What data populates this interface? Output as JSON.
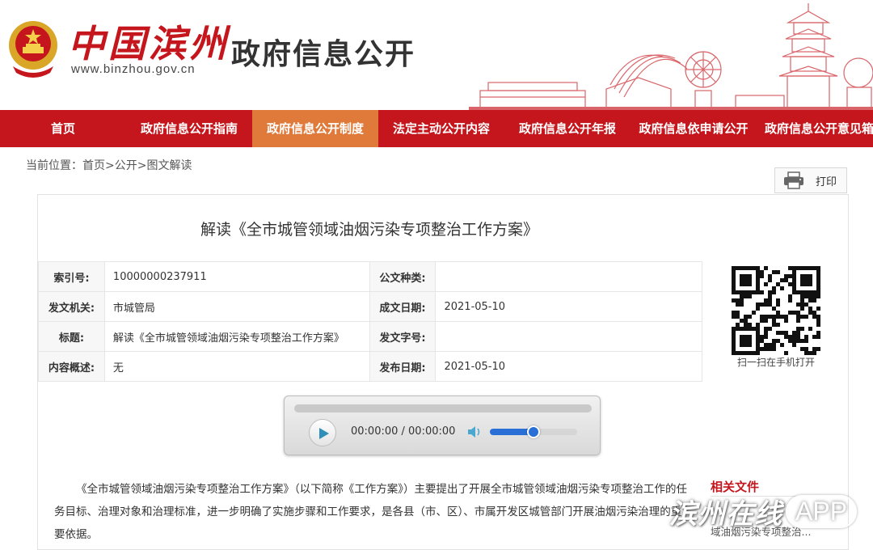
{
  "header": {
    "logo_text": "中国滨州",
    "logo_url": "www.binzhou.gov.cn",
    "site_title": "政府信息公开",
    "brand_color": "#c4161c"
  },
  "nav": {
    "items": [
      {
        "label": "首页"
      },
      {
        "label": "政府信息公开指南"
      },
      {
        "label": "政府信息公开制度",
        "active": true
      },
      {
        "label": "法定主动公开内容"
      },
      {
        "label": "政府信息公开年报"
      },
      {
        "label": "政府信息依申请公开"
      },
      {
        "label": "政府信息公开意见箱"
      }
    ],
    "active_color": "#e07a3a"
  },
  "breadcrumb": {
    "prefix": "当前位置：",
    "items": [
      "首页",
      "公开",
      "图文解读"
    ],
    "separator": ">"
  },
  "print": {
    "label": "打印",
    "icon": "printer-icon"
  },
  "document": {
    "title": "解读《全市城管领域油烟污染专项整治工作方案》",
    "meta": [
      {
        "k1": "索引号:",
        "v1": "10000000237911",
        "k2": "公文种类:",
        "v2": ""
      },
      {
        "k1": "发文机关:",
        "v1": "市城管局",
        "k2": "成文日期:",
        "v2": "2021-05-10"
      },
      {
        "k1": "标题:",
        "v1": "解读《全市城管领域油烟污染专项整治工作方案》",
        "k2": "发文字号:",
        "v2": ""
      },
      {
        "k1": "内容概述:",
        "v1": "无",
        "k2": "发布日期:",
        "v2": "2021-05-10"
      }
    ],
    "qr_caption": "扫一扫在手机打开",
    "body": "《全市城管领域油烟污染专项整治工作方案》（以下简称《工作方案》）主要提出了开展全市城管领域油烟污染专项整治工作的任务目标、治理对象和治理标准，进一步明确了实施步骤和工作要求，是各县（市、区）、市属开发区城管部门开展油烟污染治理的重要依据。"
  },
  "player": {
    "time": "00:00:00 / 00:00:00",
    "volume": 0.5,
    "accent": "#2a6fd6"
  },
  "related": {
    "title": "相关文件",
    "item": "域油烟污染专项整治..."
  },
  "watermark": {
    "text": "滨州在线",
    "app": "APP"
  }
}
